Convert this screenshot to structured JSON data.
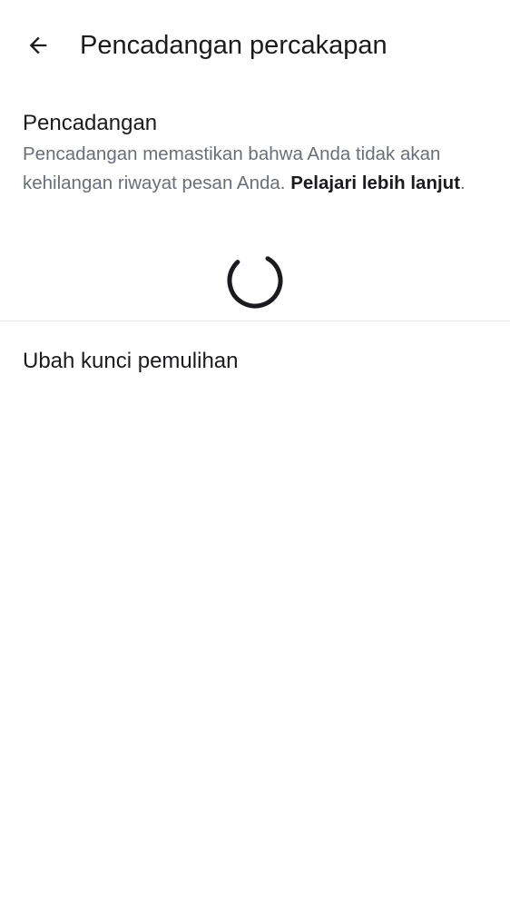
{
  "header": {
    "back_icon": "arrow-left-icon",
    "title": "Pencadangan percakapan"
  },
  "backup_section": {
    "heading": "Pencadangan",
    "description": "Pencadangan memastikan bahwa Anda tidak akan kehilangan riwayat pesan Anda. ",
    "learn_more": "Pelajari lebih lanjut",
    "period": ".",
    "status": "loading"
  },
  "settings": {
    "change_recovery_key": "Ubah kunci pemulihan"
  },
  "colors": {
    "text_primary": "#1b1b1f",
    "text_secondary": "#6b6e7a",
    "divider": "#e6e6ea",
    "background": "#ffffff"
  }
}
